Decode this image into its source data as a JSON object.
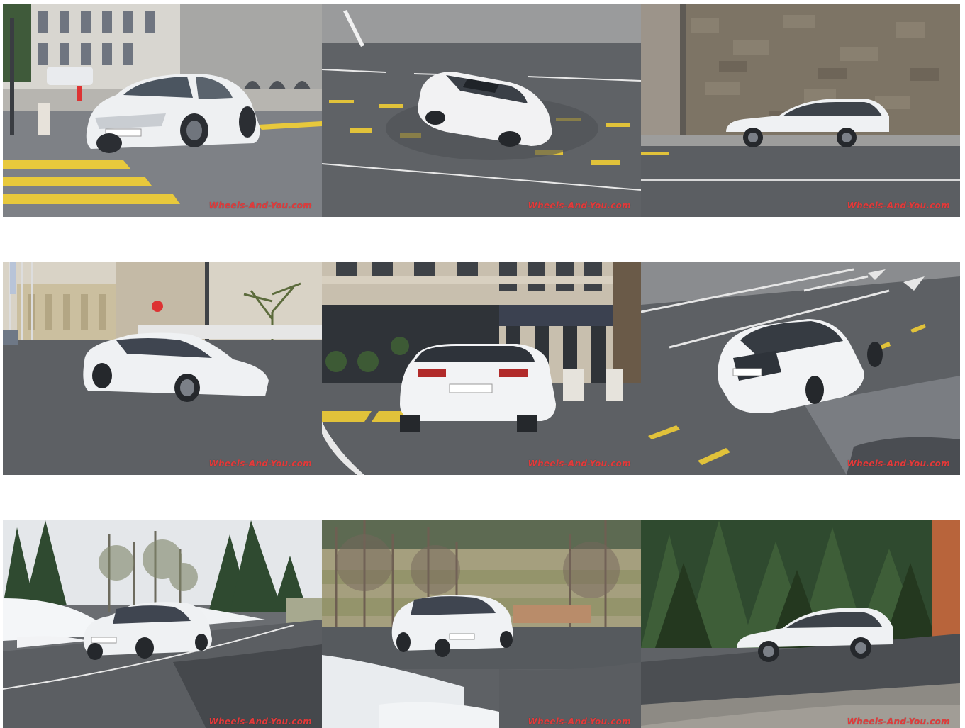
{
  "gallery": {
    "watermark": "Wheels-And-You.com",
    "accent_color": "#e23a3a",
    "photos": [
      {
        "id": 1,
        "scene": "city-crossing-front"
      },
      {
        "id": 2,
        "scene": "road-overhead-sunroof"
      },
      {
        "id": 3,
        "scene": "stone-wall-side"
      },
      {
        "id": 4,
        "scene": "plaza-three-quarter"
      },
      {
        "id": 5,
        "scene": "street-rear"
      },
      {
        "id": 6,
        "scene": "road-overhead-rear"
      },
      {
        "id": 7,
        "scene": "forest-snow-front"
      },
      {
        "id": 8,
        "scene": "hill-snow-front"
      },
      {
        "id": 9,
        "scene": "forest-road-side"
      }
    ]
  }
}
